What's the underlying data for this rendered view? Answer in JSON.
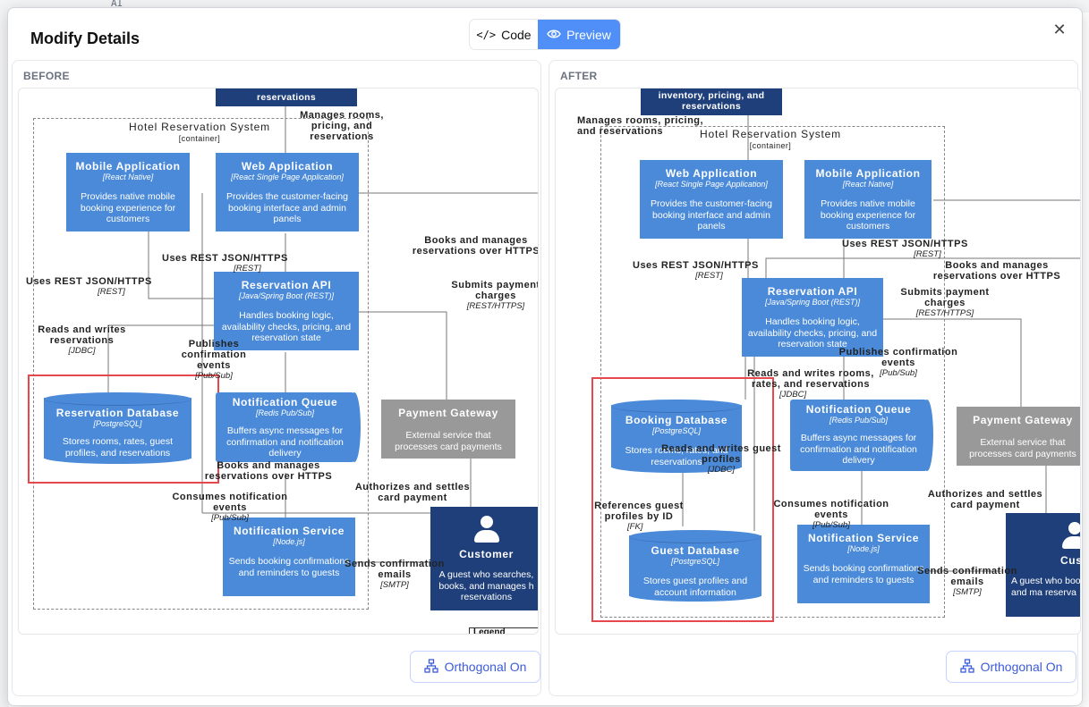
{
  "background": {
    "code_fragment": "AI"
  },
  "header": {
    "title": "Modify Details",
    "tab_code": "Code",
    "tab_preview": "Preview"
  },
  "before": {
    "label": "BEFORE",
    "orth_label": "Orthogonal On",
    "top_box_text": "reservations",
    "container_title": "Hotel Reservation System",
    "container_tag": "[container]",
    "mobile": {
      "title": "Mobile Application",
      "tech": "[React Native]",
      "desc": "Provides native mobile booking experience for customers"
    },
    "web": {
      "title": "Web Application",
      "tech": "[React Single Page Application]",
      "desc": "Provides the customer-facing booking interface and admin panels"
    },
    "api": {
      "title": "Reservation API",
      "tech": "[Java/Spring Boot (REST)]",
      "desc": "Handles booking logic, availability checks, pricing, and reservation state"
    },
    "db": {
      "title": "Reservation Database",
      "tech": "[PostgreSQL]",
      "desc": "Stores rooms, rates, guest profiles, and reservations"
    },
    "queue": {
      "title": "Notification Queue",
      "tech": "[Redis Pub/Sub]",
      "desc": "Buffers async messages for confirmation and notification delivery"
    },
    "payment": {
      "title": "Payment Gateway",
      "desc": "External service that processes card payments"
    },
    "notify": {
      "title": "Notification Service",
      "tech": "[Node.js]",
      "desc": "Sends booking confirmations and reminders to guests"
    },
    "customer": {
      "title": "Customer",
      "desc": "A guest who searches, books, and manages h reservations"
    },
    "legend": "Legend",
    "e_manages": "Manages rooms, pricing, and reservations",
    "e_uses_web": "Uses REST JSON/HTTPS",
    "e_uses_web_t": "[REST]",
    "e_uses_mob": "Uses REST JSON/HTTPS",
    "e_uses_mob_t": "[REST]",
    "e_reads": "Reads and writes reservations",
    "e_reads_t": "[JDBC]",
    "e_publishes": "Publishes confirmation events",
    "e_publishes_t": "[Pub/Sub]",
    "e_books": "Books and manages reservations over HTTPS",
    "e_submits": "Submits payment charges",
    "e_submits_t": "[REST/HTTPS]",
    "e_books2": "Books and manages reservations over HTTPS",
    "e_auth": "Authorizes and settles card payment",
    "e_consumes": "Consumes notification events",
    "e_consumes_t": "[Pub/Sub]",
    "e_sends": "Sends confirmation emails",
    "e_sends_t": "[SMTP]"
  },
  "after": {
    "label": "AFTER",
    "orth_label": "Orthogonal On",
    "top_box_text": "inventory, pricing, and reservations",
    "container_title": "Hotel Reservation System",
    "container_tag": "[container]",
    "web": {
      "title": "Web Application",
      "tech": "[React Single Page Application]",
      "desc": "Provides the customer-facing booking interface and admin panels"
    },
    "mobile": {
      "title": "Mobile Application",
      "tech": "[React Native]",
      "desc": "Provides native mobile booking experience for customers"
    },
    "api": {
      "title": "Reservation API",
      "tech": "[Java/Spring Boot (REST)]",
      "desc": "Handles booking logic, availability checks, pricing, and reservation state"
    },
    "booking_db": {
      "title": "Booking Database",
      "tech": "[PostgreSQL]",
      "desc": "Stores rooms, rates, and reservations"
    },
    "guest_db": {
      "title": "Guest Database",
      "tech": "[PostgreSQL]",
      "desc": "Stores guest profiles and account information"
    },
    "queue": {
      "title": "Notification Queue",
      "tech": "[Redis Pub/Sub]",
      "desc": "Buffers async messages for confirmation and notification delivery"
    },
    "payment": {
      "title": "Payment Gateway",
      "desc": "External service that processes card payments"
    },
    "notify": {
      "title": "Notification Service",
      "tech": "[Node.js]",
      "desc": "Sends booking confirmations and reminders to guests"
    },
    "customer": {
      "title": "Custo",
      "desc": "A guest who books, and ma reserva"
    },
    "e_manages": "Manages rooms, pricing, and reservations",
    "e_uses_web": "Uses REST JSON/HTTPS",
    "e_uses_web_t": "[REST]",
    "e_uses_mob": "Uses REST JSON/HTTPS",
    "e_uses_mob_t": "[REST]",
    "e_books": "Books and manages reservations over HTTPS",
    "e_submits": "Submits payment charges",
    "e_submits_t": "[REST/HTTPS]",
    "e_publishes": "Publishes confirmation events",
    "e_publishes_t": "[Pub/Sub]",
    "e_reads_rooms": "Reads and writes rooms, rates, and reservations",
    "e_reads_rooms_t": "[JDBC]",
    "e_reads_guest": "Reads and writes guest profiles",
    "e_reads_guest_t": "[JDBC]",
    "e_refs": "References guest profiles by ID",
    "e_refs_t": "[FK]",
    "e_auth": "Authorizes and settles card payment",
    "e_consumes": "Consumes notification events",
    "e_consumes_t": "[Pub/Sub]",
    "e_sends": "Sends confirmation emails",
    "e_sends_t": "[SMTP]"
  }
}
